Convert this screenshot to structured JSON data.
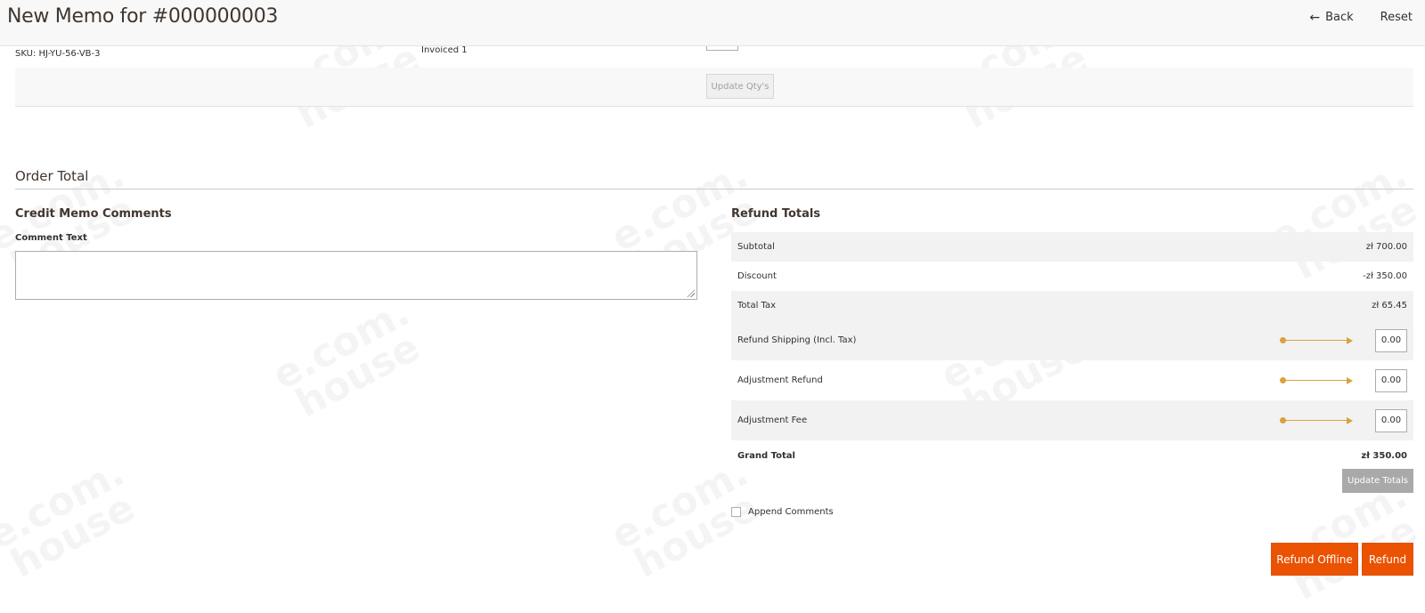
{
  "header": {
    "title": "New Memo for #000000003",
    "back_label": "Back",
    "reset_label": "Reset"
  },
  "items": {
    "sku": "SKU: HJ-YU-56-VB-3",
    "invoiced": "Invoiced 1",
    "update_qty_label": "Update Qty's"
  },
  "order_total": {
    "title": "Order Total"
  },
  "comments": {
    "title": "Credit Memo Comments",
    "label": "Comment Text",
    "value": ""
  },
  "refund_totals": {
    "title": "Refund Totals",
    "subtotal_label": "Subtotal",
    "subtotal_value": "zł 700.00",
    "discount_label": "Discount",
    "discount_value": "-zł 350.00",
    "tax_label": "Total Tax",
    "tax_value": "zł 65.45",
    "shipping_label": "Refund Shipping (Incl. Tax)",
    "shipping_value": "0.00",
    "adjustment_refund_label": "Adjustment Refund",
    "adjustment_refund_value": "0.00",
    "adjustment_fee_label": "Adjustment Fee",
    "adjustment_fee_value": "0.00",
    "grand_total_label": "Grand Total",
    "grand_total_value": "zł 350.00",
    "update_totals_label": "Update Totals"
  },
  "actions": {
    "append_comments_label": "Append Comments",
    "append_checked": false,
    "refund_offline_label": "Refund Offline",
    "refund_label": "Refund"
  },
  "watermark": {
    "text_line1": "e.com.",
    "text_line2": "house"
  },
  "colors": {
    "primary_button": "#eb5202",
    "disabled_button": "#a9a9a9",
    "annotation_arrow": "#d9a23a"
  }
}
